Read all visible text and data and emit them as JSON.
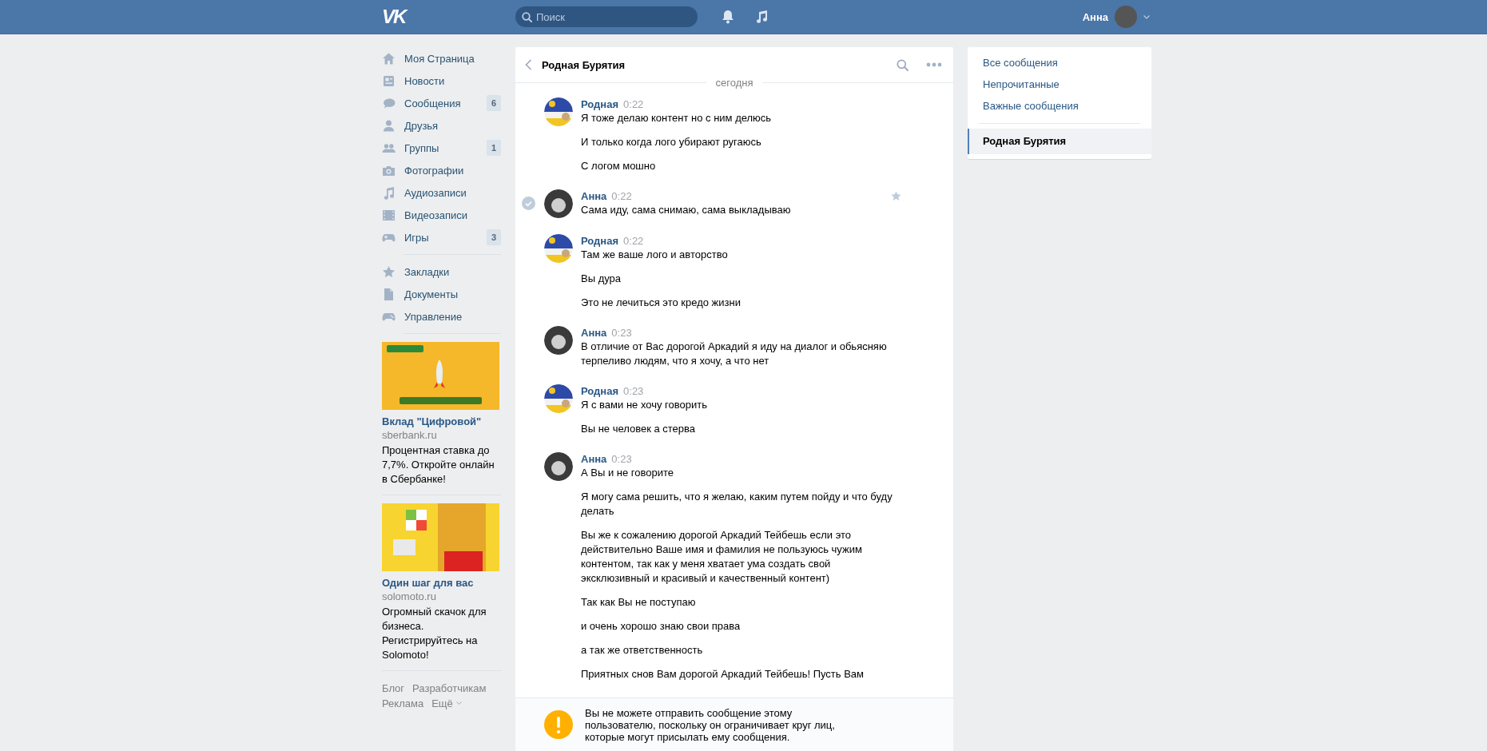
{
  "header": {
    "logo": "VK",
    "search": {
      "placeholder": "Поиск"
    },
    "user": {
      "name": "Анна"
    }
  },
  "sidebar": {
    "items": [
      {
        "label": "Моя Страница"
      },
      {
        "label": "Новости"
      },
      {
        "label": "Сообщения",
        "badge": "6"
      },
      {
        "label": "Друзья"
      },
      {
        "label": "Группы",
        "badge": "1"
      },
      {
        "label": "Фотографии"
      },
      {
        "label": "Аудиозаписи"
      },
      {
        "label": "Видеозаписи"
      },
      {
        "label": "Игры",
        "badge": "3"
      },
      {
        "label": "Закладки"
      },
      {
        "label": "Документы"
      },
      {
        "label": "Управление"
      }
    ],
    "ads": [
      {
        "kind": "bank",
        "title": "Вклад \"Цифровой\"",
        "domain": "sberbank.ru",
        "text": "Процентная ставка до 7,7%. Откройте онлайн в Сбербанке!"
      },
      {
        "kind": "photo",
        "title": "Один шаг для вас",
        "domain": "solomoto.ru",
        "text": "Огромный скачок для бизнеса. Регистрируйтесь на Solomoto!"
      }
    ],
    "footer": [
      {
        "label": "Блог"
      },
      {
        "label": "Разработчикам"
      },
      {
        "label": "Реклама"
      },
      {
        "label": "Ещё",
        "dropdown": true
      }
    ]
  },
  "chat": {
    "title": "Родная Бурятия",
    "date": "сегодня",
    "messages": [
      {
        "author": "Родная",
        "time": "0:22",
        "kind": "group",
        "hover": false,
        "texts": [
          "Я тоже делаю контент но с ним делюсь",
          "И только когда лого убирают ругаюсь",
          "С логом мошно"
        ]
      },
      {
        "author": "Анна",
        "time": "0:22",
        "kind": "user",
        "hover": true,
        "texts": [
          "Сама иду, сама снимаю, сама выкладываю"
        ]
      },
      {
        "author": "Родная",
        "time": "0:22",
        "kind": "group",
        "hover": false,
        "texts": [
          "Там же ваше лого и авторство",
          "Вы дура",
          "Это не лечиться это кредо жизни"
        ]
      },
      {
        "author": "Анна",
        "time": "0:23",
        "kind": "user",
        "hover": false,
        "texts": [
          "В отличие от Вас дорогой Аркадий я иду на диалог и обьясняю терпеливо людям, что я хочу, а что нет"
        ]
      },
      {
        "author": "Родная",
        "time": "0:23",
        "kind": "group",
        "hover": false,
        "texts": [
          "Я с вами не хочу говорить",
          "Вы не человек а стерва"
        ]
      },
      {
        "author": "Анна",
        "time": "0:23",
        "kind": "user",
        "hover": false,
        "texts": [
          "А Вы и не говорите",
          "Я могу сама решить, что я желаю, каким путем пойду и что буду делать",
          "Вы же к сожалению дорогой Аркадий Тейбешь если это действительно Ваше имя и фамилия не пользуюсь чужим контентом, так как у меня хватает ума создать свой эксклюзивный и красивый и качественный контент)",
          "Так как Вы не поступаю",
          "и очень хорошо знаю свои права",
          "а так же ответственность",
          "Приятных снов Вам дорогой Аркадий Тейбешь! Пусть Вам"
        ]
      }
    ],
    "notice": "Вы не можете отправить сообщение этому пользователю, поскольку он ограничивает круг лиц, которые могут присылать ему сообщения."
  },
  "right_menu": {
    "items": [
      {
        "label": "Все сообщения",
        "kind": "filter",
        "selected": false
      },
      {
        "label": "Непрочитанные",
        "kind": "filter",
        "selected": false
      },
      {
        "label": "Важные сообщения",
        "kind": "filter",
        "selected": false
      },
      {
        "label": "Родная Бурятия",
        "kind": "dialog",
        "selected": true
      }
    ]
  }
}
